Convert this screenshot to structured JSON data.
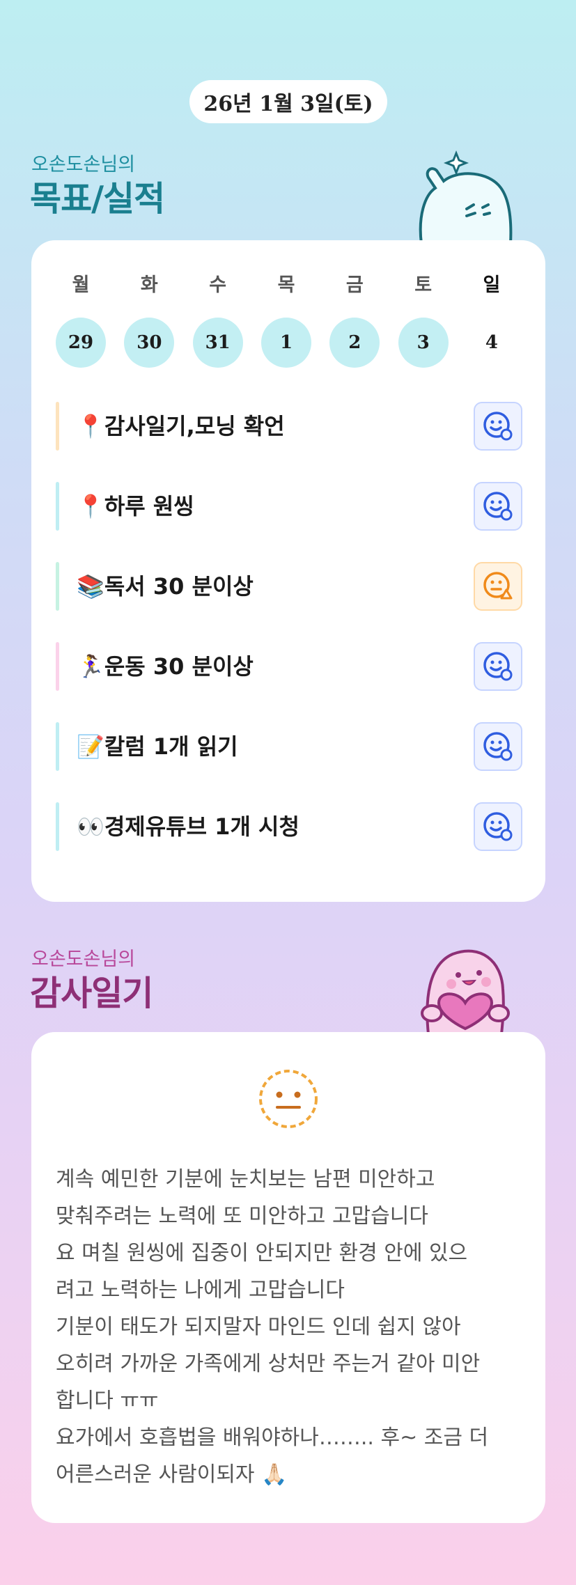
{
  "date_label": "26년 1월 3일(토)",
  "goals_section": {
    "subtitle": "오손도손님의",
    "title": "목표/실적"
  },
  "week": {
    "day_names": [
      "월",
      "화",
      "수",
      "목",
      "금",
      "토",
      "일"
    ],
    "dates": [
      "29",
      "30",
      "31",
      "1",
      "2",
      "3",
      "4"
    ]
  },
  "goals": [
    {
      "label": "📍감사일기,모닝 확언",
      "bar_color": "#fde3bd",
      "status_icon": "smile-badge-icon"
    },
    {
      "label": "📍하루 원씽",
      "bar_color": "#bfeef3",
      "status_icon": "smile-badge-icon"
    },
    {
      "label": "📚독서 30 분이상",
      "bar_color": "#c6f2e2",
      "status_icon": "meh-warning-icon"
    },
    {
      "label": "🏃‍♀️운동 30 분이상",
      "bar_color": "#fbd2ea",
      "status_icon": "smile-badge-icon"
    },
    {
      "label": "📝칼럼 1개 읽기",
      "bar_color": "#bfeef3",
      "status_icon": "smile-badge-icon"
    },
    {
      "label": "👀경제유튜브 1개 시청",
      "bar_color": "#bfeef3",
      "status_icon": "smile-badge-icon"
    }
  ],
  "diary_section": {
    "subtitle": "오손도손님의",
    "title": "감사일기"
  },
  "diary": {
    "mood_icon": "neutral-face-icon",
    "text": "계속 예민한 기분에 눈치보는 남편 미안하고\n맞춰주려는 노력에 또 미안하고 고맙습니다\n요 며칠 원씽에 집중이 안되지만 환경 안에 있으\n려고 노력하는 나에게 고맙습니다\n기분이 태도가 되지말자 마인드 인데 쉽지 않아\n오히려 가까운 가족에게 상처만 주는거 같아 미안\n합니다 ㅠㅠ\n요가에서 호흡법을 배워야하나…….. 후~ 조금 더\n어른스러운 사람이되자 🙏🏻"
  },
  "colors": {
    "ok_icon": "#2f5de0",
    "warn_icon": "#f08a1a",
    "teal_title": "#1a7f8f",
    "purple_title": "#8e2f76"
  }
}
